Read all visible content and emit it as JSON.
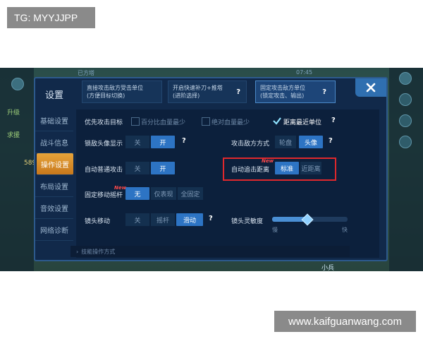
{
  "watermarks": {
    "top": "TG: MYYJJPP",
    "bottom": "www.kaifguanwang.com"
  },
  "hud": {
    "top_left": "已方塔",
    "time": "07:45",
    "level": "升级",
    "help": "求援",
    "gold": "589",
    "minion": "小兵"
  },
  "dialog": {
    "title": "设置",
    "close_icon": "close-icon"
  },
  "sidebar": {
    "items": [
      {
        "label": "基础设置",
        "active": false
      },
      {
        "label": "战斗信息",
        "active": false
      },
      {
        "label": "操作设置",
        "active": true
      },
      {
        "label": "布局设置",
        "active": false
      },
      {
        "label": "音效设置",
        "active": false
      },
      {
        "label": "网络诊断",
        "active": false
      }
    ]
  },
  "cards": [
    {
      "line1": "直接攻击敌方受击单位",
      "line2": "(方便目标切换)"
    },
    {
      "line1": "开启快速补刀+推塔",
      "line2": "(进阶选择)"
    },
    {
      "line1": "固定攻击敌方单位",
      "line2": "(锁定攻击、输出)"
    }
  ],
  "help_mark": "?",
  "priority": {
    "label": "优先攻击目标",
    "options": [
      "百分比血量最少",
      "绝对血量最少",
      "距离最近单位"
    ],
    "selected": "距离最近单位"
  },
  "lock_avatar": {
    "label": "锁敌头像显示",
    "off": "关",
    "on": "开"
  },
  "attack_enemy_mode": {
    "label": "攻击敌方方式",
    "option_a": "轮盘",
    "option_b": "头像",
    "selected": "头像"
  },
  "auto_normal_attack": {
    "label": "自动普通攻击",
    "off": "关",
    "on": "开"
  },
  "auto_chase": {
    "label": "自动追击距离",
    "new": "New",
    "option_a": "标准",
    "option_b": "近距离",
    "selected": "标准"
  },
  "fixed_joystick": {
    "label": "固定移动摇杆",
    "new": "New",
    "options": [
      "无",
      "仅表现",
      "全固定"
    ],
    "selected": "无"
  },
  "camera_move": {
    "label": "镜头移动",
    "options": [
      "关",
      "摇杆",
      "滑动"
    ],
    "selected": "滑动"
  },
  "camera_sensitivity": {
    "label": "镜头灵敏度",
    "min_label": "慢",
    "max_label": "快",
    "value": 0.47
  },
  "footer": {
    "label": "技能操作方式"
  }
}
